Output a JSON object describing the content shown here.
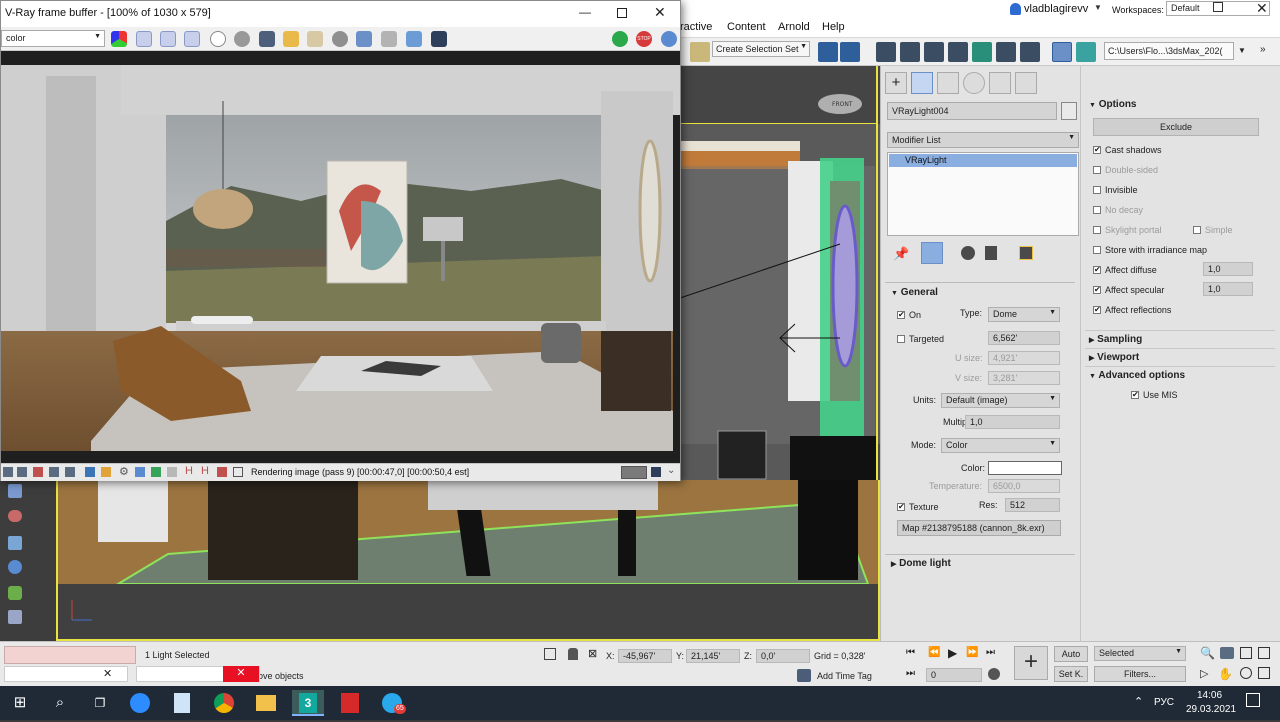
{
  "main_window": {
    "user": "vladblagirevv",
    "workspaces_label": "Workspaces:",
    "workspace_value": "Default",
    "menu": [
      "ractive",
      "Content",
      "Arnold",
      "Help"
    ],
    "selection_set": "Create Selection Set",
    "path": "C:\\Users\\Flo...\\3dsMax_202("
  },
  "vfb": {
    "title": "V-Ray frame buffer - [100% of 1030 x 579]",
    "channel": "color",
    "status": "Rendering image (pass 9) [00:00:47,0] [00:00:50,4 est]",
    "stop_label": "STOP"
  },
  "viewport": {
    "cube_label": "FRONT"
  },
  "command_panel": {
    "object_name": "VRayLight004",
    "modifier_list": "Modifier List",
    "modifier_item": "VRayLight",
    "general": {
      "header": "General",
      "on_label": "On",
      "on_checked": true,
      "type_label": "Type:",
      "type_value": "Dome",
      "targeted_label": "Targeted",
      "targeted_value": "6,562'",
      "usize_label": "U size:",
      "usize_value": "4,921'",
      "vsize_label": "V size:",
      "vsize_value": "3,281'",
      "units_label": "Units:",
      "units_value": "Default (image)",
      "multiplier_label": "Multiplier:",
      "multiplier_value": "1,0",
      "mode_label": "Mode:",
      "mode_value": "Color",
      "color_label": "Color:",
      "color_value": "#ffffff",
      "temperature_label": "Temperature:",
      "temperature_value": "6500,0",
      "texture_label": "Texture",
      "res_label": "Res:",
      "res_value": "512",
      "map_value": "Map #2138795188 (cannon_8k.exr)"
    },
    "dome_header": "Dome light"
  },
  "options_panel": {
    "header": "Options",
    "exclude": "Exclude",
    "cast_shadows": "Cast shadows",
    "double_sided": "Double-sided",
    "invisible": "Invisible",
    "no_decay": "No decay",
    "skylight_portal": "Skylight portal",
    "simple": "Simple",
    "store_irradiance": "Store with irradiance map",
    "affect_diffuse": "Affect diffuse",
    "affect_diffuse_value": "1,0",
    "affect_specular": "Affect specular",
    "affect_specular_value": "1,0",
    "affect_reflections": "Affect reflections",
    "sampling": "Sampling",
    "viewport": "Viewport",
    "advanced": "Advanced options",
    "use_mis": "Use MIS"
  },
  "status": {
    "selection": "1 Light Selected",
    "prompt": "ove objects",
    "x_label": "X:",
    "x_value": "-45,967'",
    "y_label": "Y:",
    "y_value": "21,145'",
    "z_label": "Z:",
    "z_value": "0,0'",
    "grid": "Grid = 0,328'",
    "add_time_tag": "Add Time Tag",
    "auto": "Auto",
    "setk": "Set K.",
    "selected": "Selected",
    "filters": "Filters...",
    "frame": "0"
  },
  "taskbar": {
    "lang": "РУС",
    "time": "14:06",
    "date": "29.03.2021",
    "badge": "65"
  },
  "colors": {
    "accent_blue": "#8aaee0",
    "frame_yellow": "#e8e33f",
    "taskbar_bg": "#1f2a36"
  }
}
